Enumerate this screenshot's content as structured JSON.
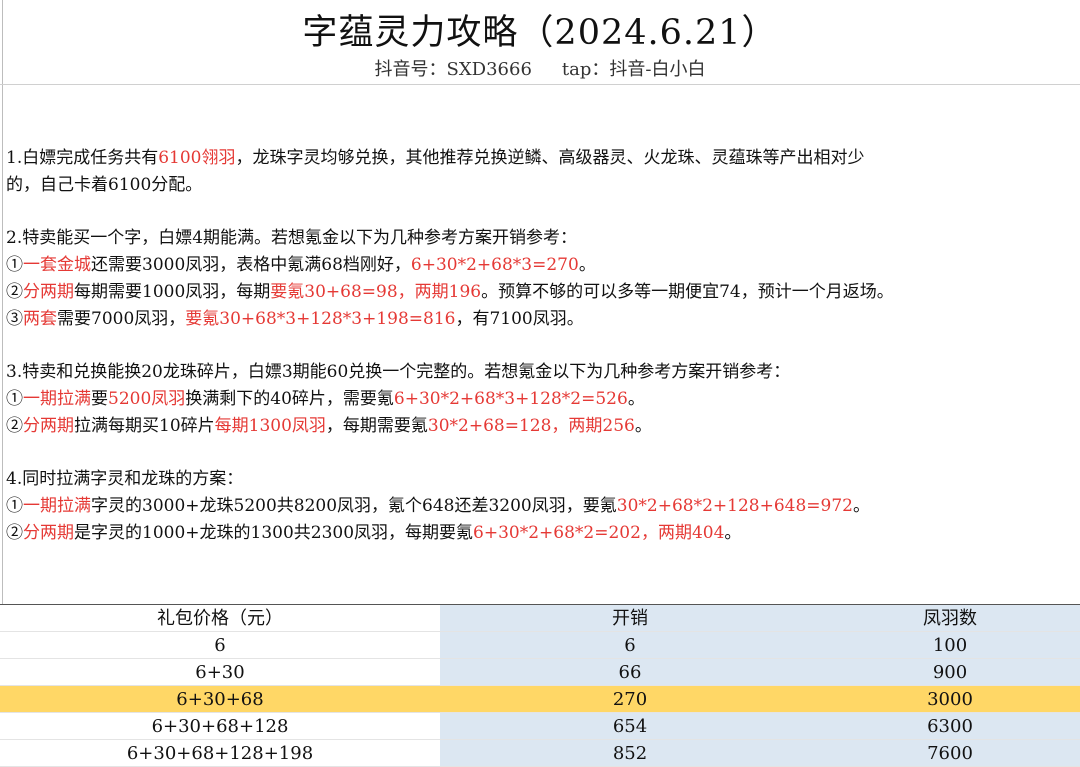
{
  "header": {
    "title": "字蕴灵力攻略（2024.6.21）",
    "douyin": "抖音号：SXD3666",
    "tap": "tap：抖音-白小白"
  },
  "lines": [
    [
      {
        "t": "1.白嫖完成任务共有"
      },
      {
        "t": "6100翎羽",
        "red": true
      },
      {
        "t": "，龙珠字灵均够兑换，其他推荐兑换逆鳞、高级器灵、火龙珠、灵蕴珠等产出相对少"
      }
    ],
    [
      {
        "t": "的，自己卡着6100分配。"
      }
    ],
    [],
    [
      {
        "t": "2.特卖能买一个字，白嫖4期能满。若想氪金以下为几种参考方案开销参考："
      }
    ],
    [
      {
        "t": "①"
      },
      {
        "t": "一套金城",
        "red": true
      },
      {
        "t": "还需要3000凤羽，表格中氪满68档刚好，"
      },
      {
        "t": "6+30*2+68*3=270",
        "red": true
      },
      {
        "t": "。"
      }
    ],
    [
      {
        "t": "②"
      },
      {
        "t": "分两期",
        "red": true
      },
      {
        "t": "每期需要1000凤羽，每期"
      },
      {
        "t": "要氪30+68=98，两期196",
        "red": true
      },
      {
        "t": "。预算不够的可以多等一期便宜74，预计一个月返场。"
      }
    ],
    [
      {
        "t": "③"
      },
      {
        "t": "两套",
        "red": true
      },
      {
        "t": "需要7000凤羽，"
      },
      {
        "t": "要氪30+68*3+128*3+198=816",
        "red": true
      },
      {
        "t": "，有7100凤羽。"
      }
    ],
    [],
    [
      {
        "t": "3.特卖和兑换能换20龙珠碎片，白嫖3期能60兑换一个完整的。若想氪金以下为几种参考方案开销参考："
      }
    ],
    [
      {
        "t": "①"
      },
      {
        "t": "一期拉满",
        "red": true
      },
      {
        "t": "要"
      },
      {
        "t": "5200凤羽",
        "red": true
      },
      {
        "t": "换满剩下的40碎片，需要氪"
      },
      {
        "t": "6+30*2+68*3+128*2=526",
        "red": true
      },
      {
        "t": "。"
      }
    ],
    [
      {
        "t": "②"
      },
      {
        "t": "分两期",
        "red": true
      },
      {
        "t": "拉满每期买10碎片"
      },
      {
        "t": "每期1300凤羽",
        "red": true
      },
      {
        "t": "，每期需要氪"
      },
      {
        "t": "30*2+68=128，两期256",
        "red": true
      },
      {
        "t": "。"
      }
    ],
    [],
    [
      {
        "t": "4.同时拉满字灵和龙珠的方案："
      }
    ],
    [
      {
        "t": "①"
      },
      {
        "t": "一期拉满",
        "red": true
      },
      {
        "t": "字灵的3000+龙珠5200共8200凤羽，氪个648还差3200凤羽，要氪"
      },
      {
        "t": "30*2+68*2+128+648=972",
        "red": true
      },
      {
        "t": "。"
      }
    ],
    [
      {
        "t": "②"
      },
      {
        "t": "分两期",
        "red": true
      },
      {
        "t": "是字灵的1000+龙珠的1300共2300凤羽，每期要氪"
      },
      {
        "t": "6+30*2+68*2=202，两期404",
        "red": true
      },
      {
        "t": "。"
      }
    ]
  ],
  "table": {
    "headers": [
      "礼包价格（元）",
      "开销",
      "凤羽数"
    ],
    "rows": [
      {
        "cells": [
          "6",
          "6",
          "100"
        ]
      },
      {
        "cells": [
          "6+30",
          "66",
          "900"
        ]
      },
      {
        "cells": [
          "6+30+68",
          "270",
          "3000"
        ],
        "highlight": true
      },
      {
        "cells": [
          "6+30+68+128",
          "654",
          "6300"
        ]
      },
      {
        "cells": [
          "6+30+68+128+198",
          "852",
          "7600"
        ]
      }
    ]
  },
  "colors": {
    "accent_red": "#e53935",
    "table_blue": "#dce7f2",
    "highlight_yellow": "#ffd766"
  }
}
